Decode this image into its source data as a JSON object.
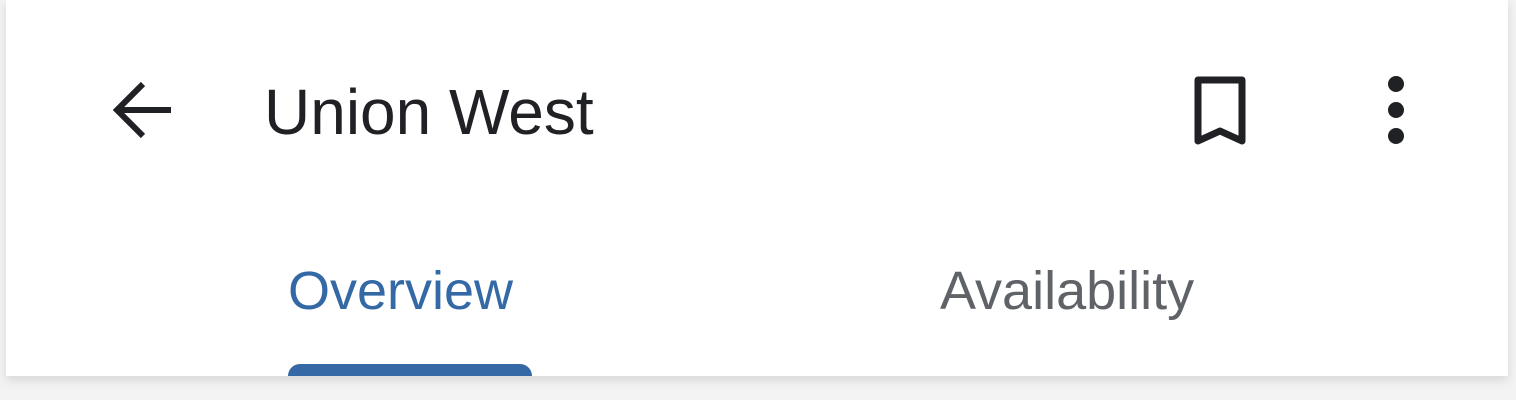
{
  "header": {
    "back_icon": "arrow-back-icon",
    "title": "Union West",
    "bookmark_icon": "bookmark-outline-icon",
    "more_icon": "more-vert-icon"
  },
  "tabs": [
    {
      "label": "Overview",
      "selected": true
    },
    {
      "label": "Availability",
      "selected": false
    }
  ],
  "colors": {
    "accent": "#3469a6",
    "text_primary": "#202124",
    "text_secondary": "#5f6368",
    "background": "#ffffff"
  }
}
